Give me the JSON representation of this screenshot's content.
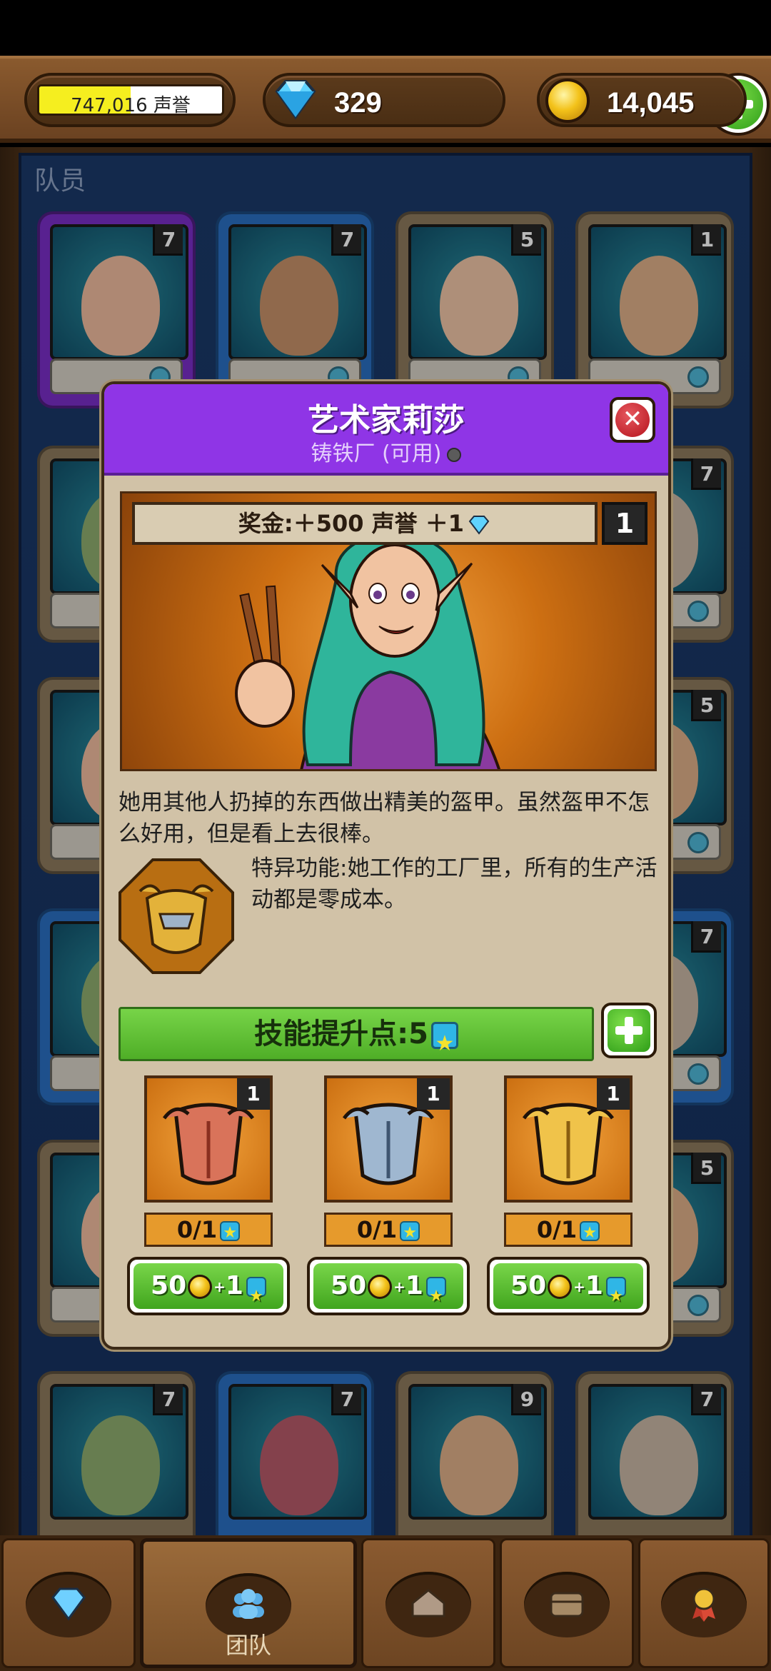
{
  "topbar": {
    "reputation_text": "747,016 声誉",
    "reputation_progress": 0.5,
    "gems": "329",
    "gold": "14,045"
  },
  "section": {
    "title": "队员"
  },
  "team_cards": [
    {
      "level": "7",
      "color": "#7a2fc8"
    },
    {
      "level": "7",
      "color": "#2a6fc2"
    },
    {
      "level": "5",
      "color": "#8e7a5e"
    },
    {
      "level": "1",
      "color": "#8e7a5e"
    },
    {
      "level": "7",
      "color": "#8e7a5e"
    },
    {
      "level": "5",
      "color": "#8e7a5e"
    },
    {
      "level": "7",
      "color": "#2a6fc2"
    },
    {
      "level": "5",
      "color": "#8e7a5e"
    },
    {
      "level": "7",
      "color": "#8e7a5e"
    },
    {
      "level": "7",
      "color": "#2a6fc2"
    },
    {
      "level": "9",
      "color": "#8e7a5e"
    },
    {
      "level": "7",
      "color": "#8e7a5e"
    }
  ],
  "modal": {
    "title": "艺术家莉莎",
    "subtitle": "铸铁厂 (可用)",
    "bonus": "奖金:＋500 声誉 ＋1",
    "level": "1",
    "description": "她用其他人扔掉的东西做出精美的盔甲。虽然盔甲不怎么好用，但是看上去很棒。",
    "perk": "特异功能:她工作的工厂里，所有的生产活动都是零成本。",
    "skill_points_label": "技能提升点:5",
    "upgrades": [
      {
        "level": "1",
        "progress": "0/1",
        "cost_gold": "50",
        "cost_points": "1",
        "armor": "leather"
      },
      {
        "level": "1",
        "progress": "0/1",
        "cost_gold": "50",
        "cost_points": "1",
        "armor": "steel"
      },
      {
        "level": "1",
        "progress": "0/1",
        "cost_gold": "50",
        "cost_points": "1",
        "armor": "gold"
      }
    ]
  },
  "nav": {
    "items": [
      {
        "icon": "gem-icon"
      },
      {
        "icon": "team-icon",
        "label": "团队",
        "active": true
      },
      {
        "icon": "factory-icon"
      },
      {
        "icon": "chest-icon"
      },
      {
        "icon": "medal-icon"
      }
    ]
  },
  "colors": {
    "modal_header": "#8f35e6",
    "skill_bar": "#5db832",
    "accent_green": "#41a51e"
  }
}
